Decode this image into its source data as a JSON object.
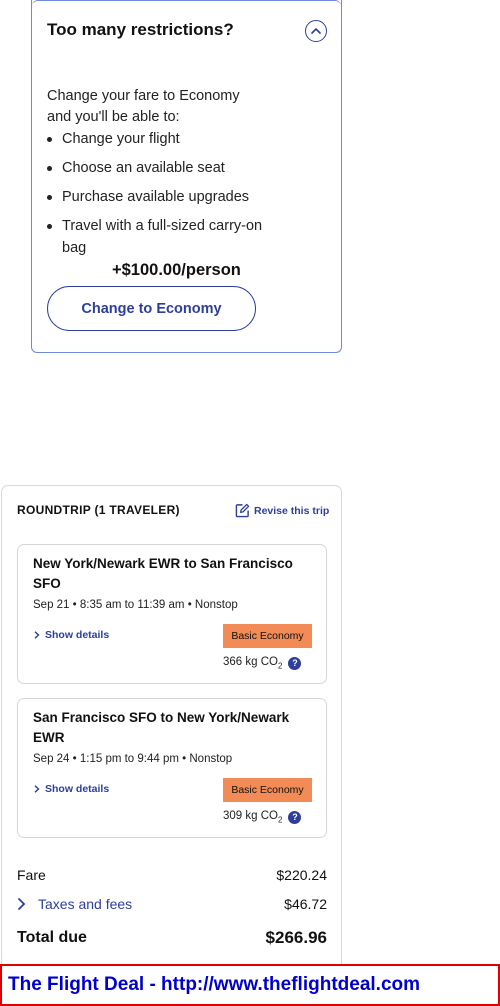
{
  "upsell": {
    "title": "Too many restrictions?",
    "intro": "Change your fare to Economy and you'll be able to:",
    "benefits": [
      "Change your flight",
      "Choose an available seat",
      "Purchase available upgrades",
      "Travel with a full-sized carry-on bag"
    ],
    "price": "+$100.00/person",
    "button_label": "Change to Economy"
  },
  "summary": {
    "title": "ROUNDTRIP (1 TRAVELER)",
    "revise_label": "Revise this trip",
    "segments": [
      {
        "route": "New York/Newark EWR to San Francisco SFO",
        "info": "Sep 21 • 8:35 am to 11:39 am • Nonstop",
        "details_label": "Show details",
        "fare_class": "Basic Economy",
        "co2_value": "366 kg CO",
        "co2_sub": "2"
      },
      {
        "route": "San Francisco SFO to New York/Newark EWR",
        "info": "Sep 24 • 1:15 pm to 9:44 pm • Nonstop",
        "details_label": "Show details",
        "fare_class": "Basic Economy",
        "co2_value": "309 kg CO",
        "co2_sub": "2"
      }
    ],
    "fare_label": "Fare",
    "fare_amount": "$220.24",
    "taxes_label": "Taxes and fees",
    "taxes_amount": "$46.72",
    "total_label": "Total due",
    "total_amount": "$266.96"
  },
  "watermark": {
    "text": "The Flight Deal - http://www.theflightdeal.com"
  },
  "colors": {
    "accent": "#2d3f9b",
    "badge": "#f28b55",
    "watermark_border": "#e00000",
    "watermark_text": "#0000cc"
  },
  "icons": {
    "collapse": "chevron-up-circle-icon",
    "revise": "edit-icon",
    "details": "chevron-right-icon",
    "co2_help": "help-icon"
  }
}
